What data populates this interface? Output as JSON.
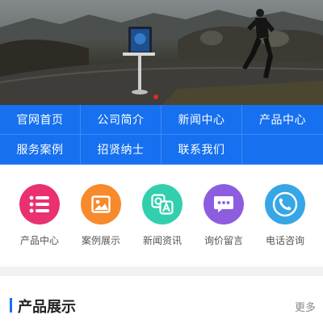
{
  "colors": {
    "nav_bg": "#1670f0",
    "accent": "#1670f0",
    "banner_dot": "#e02a1f"
  },
  "banner": {
    "image": "runner-on-road-with-kiosk"
  },
  "nav": {
    "items": [
      {
        "label": "官网首页"
      },
      {
        "label": "公司简介"
      },
      {
        "label": "新闻中心"
      },
      {
        "label": "产品中心"
      },
      {
        "label": "服务案例"
      },
      {
        "label": "招贤纳士"
      },
      {
        "label": "联系我们"
      },
      {
        "label": ""
      }
    ]
  },
  "quick": {
    "items": [
      {
        "label": "产品中心",
        "icon": "list-icon",
        "color": "#ea3071"
      },
      {
        "label": "案例展示",
        "icon": "image-icon",
        "color": "#f78a2b"
      },
      {
        "label": "新闻资讯",
        "icon": "news-qa-icon",
        "color": "#32cfae"
      },
      {
        "label": "询价留言",
        "icon": "chat-bubble-icon",
        "color": "#8d5de0"
      },
      {
        "label": "电话咨询",
        "icon": "phone-icon",
        "color": "#36a6e6"
      }
    ]
  },
  "section": {
    "title": "产品展示",
    "more": "更多"
  }
}
